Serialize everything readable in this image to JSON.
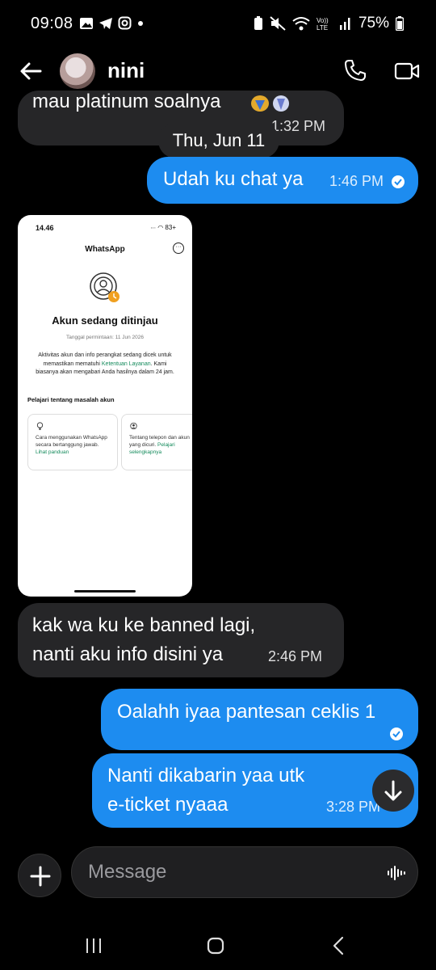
{
  "status_bar": {
    "time": "09:08",
    "battery": "75%"
  },
  "header": {
    "contact_name": "nini"
  },
  "messages": [
    {
      "direction": "incoming",
      "text": "mau platinum soalnya",
      "time": "1:32 PM"
    },
    {
      "direction": "outgoing",
      "text": "Udah ku chat ya",
      "time": "1:46 PM"
    },
    {
      "direction": "incoming",
      "text": "kak wa ku ke banned lagi,\nnanti aku info disini ya",
      "time": "2:46 PM"
    },
    {
      "direction": "outgoing",
      "text": "Oalahh iyaa pantesan ceklis 1",
      "time": ""
    },
    {
      "direction": "outgoing",
      "text": "Nanti dikabarin yaa utk\ne-ticket nyaaa",
      "time": "3:28 PM"
    }
  ],
  "date_separator": "Thu, Jun 11",
  "attachment": {
    "time": "14.46",
    "status_icons": "∙∙∙ ◠ 83+",
    "app_title": "WhatsApp",
    "heading": "Akun sedang ditinjau",
    "request_date": "Tanggal permintaan: 11 Jun 2026",
    "body_before_link": "Aktivitas akun dan info perangkat sedang dicek untuk memastikan mematuhi ",
    "body_link": "Ketentuan Layanan",
    "body_after_link": ". Kami biasanya akan mengabari Anda hasilnya dalam 24 jam.",
    "learn_heading": "Pelajari tentang masalah akun",
    "card1_text": "Cara menggunakan WhatsApp secara bertanggung jawab. ",
    "card1_link": "Lihat panduan",
    "card2_text": "Tentang telepon dan akun yang dicuri. ",
    "card2_link": "Pelajari selengkapnya"
  },
  "composer": {
    "placeholder": "Message"
  },
  "colors": {
    "outgoing_bubble": "#1d8cf0",
    "incoming_bubble": "#262628",
    "background": "#000000",
    "link_green": "#138a5b"
  }
}
